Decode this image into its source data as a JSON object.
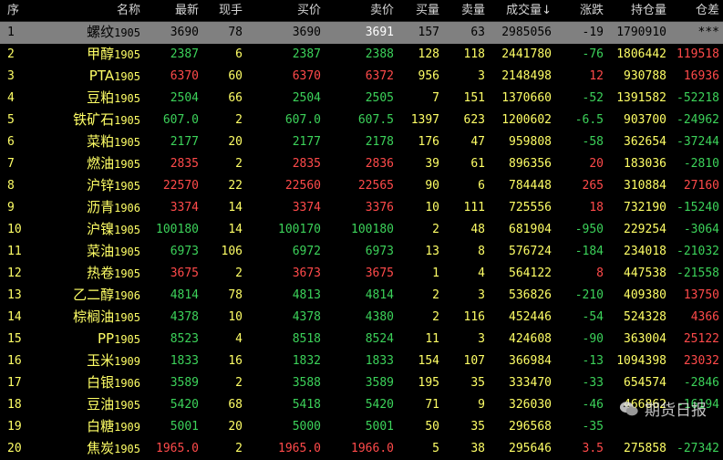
{
  "columns": [
    "序",
    "名称",
    "最新",
    "现手",
    "买价",
    "卖价",
    "买量",
    "卖量",
    "成交量↓",
    "涨跌",
    "持仓量",
    "仓差"
  ],
  "rows": [
    {
      "seq": "1",
      "name": "螺纹",
      "code": "1905",
      "last": "3690",
      "hand": "78",
      "bid": "3690",
      "ask": "3691",
      "bidv": "157",
      "askv": "63",
      "vol": "2985056",
      "chg": "-19",
      "oi": "1790910",
      "oichg": "***",
      "dir": "dn",
      "oidir": "up",
      "selected": true
    },
    {
      "seq": "2",
      "name": "甲醇",
      "code": "1905",
      "last": "2387",
      "hand": "6",
      "bid": "2387",
      "ask": "2388",
      "bidv": "128",
      "askv": "118",
      "vol": "2441780",
      "chg": "-76",
      "oi": "1806442",
      "oichg": "119518",
      "dir": "dn",
      "oidir": "up"
    },
    {
      "seq": "3",
      "name": "PTA",
      "code": "1905",
      "last": "6370",
      "hand": "60",
      "bid": "6370",
      "ask": "6372",
      "bidv": "956",
      "askv": "3",
      "vol": "2148498",
      "chg": "12",
      "oi": "930788",
      "oichg": "16936",
      "dir": "up",
      "oidir": "up"
    },
    {
      "seq": "4",
      "name": "豆粕",
      "code": "1905",
      "last": "2504",
      "hand": "66",
      "bid": "2504",
      "ask": "2505",
      "bidv": "7",
      "askv": "151",
      "vol": "1370660",
      "chg": "-52",
      "oi": "1391582",
      "oichg": "-52218",
      "dir": "dn",
      "oidir": "dn"
    },
    {
      "seq": "5",
      "name": "铁矿石",
      "code": "1905",
      "last": "607.0",
      "hand": "2",
      "bid": "607.0",
      "ask": "607.5",
      "bidv": "1397",
      "askv": "623",
      "vol": "1200602",
      "chg": "-6.5",
      "oi": "903700",
      "oichg": "-24962",
      "dir": "dn",
      "oidir": "dn"
    },
    {
      "seq": "6",
      "name": "菜粕",
      "code": "1905",
      "last": "2177",
      "hand": "20",
      "bid": "2177",
      "ask": "2178",
      "bidv": "176",
      "askv": "47",
      "vol": "959808",
      "chg": "-58",
      "oi": "362654",
      "oichg": "-37244",
      "dir": "dn",
      "oidir": "dn"
    },
    {
      "seq": "7",
      "name": "燃油",
      "code": "1905",
      "last": "2835",
      "hand": "2",
      "bid": "2835",
      "ask": "2836",
      "bidv": "39",
      "askv": "61",
      "vol": "896356",
      "chg": "20",
      "oi": "183036",
      "oichg": "-2810",
      "dir": "up",
      "oidir": "dn"
    },
    {
      "seq": "8",
      "name": "沪锌",
      "code": "1905",
      "last": "22570",
      "hand": "22",
      "bid": "22560",
      "ask": "22565",
      "bidv": "90",
      "askv": "6",
      "vol": "784448",
      "chg": "265",
      "oi": "310884",
      "oichg": "27160",
      "dir": "up",
      "oidir": "up"
    },
    {
      "seq": "9",
      "name": "沥青",
      "code": "1906",
      "last": "3374",
      "hand": "14",
      "bid": "3374",
      "ask": "3376",
      "bidv": "10",
      "askv": "111",
      "vol": "725556",
      "chg": "18",
      "oi": "732190",
      "oichg": "-15240",
      "dir": "up",
      "oidir": "dn"
    },
    {
      "seq": "10",
      "name": "沪镍",
      "code": "1905",
      "last": "100180",
      "hand": "14",
      "bid": "100170",
      "ask": "100180",
      "bidv": "2",
      "askv": "48",
      "vol": "681904",
      "chg": "-950",
      "oi": "229254",
      "oichg": "-3064",
      "dir": "dn",
      "oidir": "dn"
    },
    {
      "seq": "11",
      "name": "菜油",
      "code": "1905",
      "last": "6973",
      "hand": "106",
      "bid": "6972",
      "ask": "6973",
      "bidv": "13",
      "askv": "8",
      "vol": "576724",
      "chg": "-184",
      "oi": "234018",
      "oichg": "-21032",
      "dir": "dn",
      "oidir": "dn"
    },
    {
      "seq": "12",
      "name": "热卷",
      "code": "1905",
      "last": "3675",
      "hand": "2",
      "bid": "3673",
      "ask": "3675",
      "bidv": "1",
      "askv": "4",
      "vol": "564122",
      "chg": "8",
      "oi": "447538",
      "oichg": "-21558",
      "dir": "up",
      "oidir": "dn"
    },
    {
      "seq": "13",
      "name": "乙二醇",
      "code": "1906",
      "last": "4814",
      "hand": "78",
      "bid": "4813",
      "ask": "4814",
      "bidv": "2",
      "askv": "3",
      "vol": "536826",
      "chg": "-210",
      "oi": "409380",
      "oichg": "13750",
      "dir": "dn",
      "oidir": "up"
    },
    {
      "seq": "14",
      "name": "棕榈油",
      "code": "1905",
      "last": "4378",
      "hand": "10",
      "bid": "4378",
      "ask": "4380",
      "bidv": "2",
      "askv": "116",
      "vol": "452446",
      "chg": "-54",
      "oi": "524328",
      "oichg": "4366",
      "dir": "dn",
      "oidir": "up"
    },
    {
      "seq": "15",
      "name": "PP",
      "code": "1905",
      "last": "8523",
      "hand": "4",
      "bid": "8518",
      "ask": "8524",
      "bidv": "11",
      "askv": "3",
      "vol": "424608",
      "chg": "-90",
      "oi": "363004",
      "oichg": "25122",
      "dir": "dn",
      "oidir": "up"
    },
    {
      "seq": "16",
      "name": "玉米",
      "code": "1909",
      "last": "1833",
      "hand": "16",
      "bid": "1832",
      "ask": "1833",
      "bidv": "154",
      "askv": "107",
      "vol": "366984",
      "chg": "-13",
      "oi": "1094398",
      "oichg": "23032",
      "dir": "dn",
      "oidir": "up"
    },
    {
      "seq": "17",
      "name": "白银",
      "code": "1906",
      "last": "3589",
      "hand": "2",
      "bid": "3588",
      "ask": "3589",
      "bidv": "195",
      "askv": "35",
      "vol": "333470",
      "chg": "-33",
      "oi": "654574",
      "oichg": "-2846",
      "dir": "dn",
      "oidir": "dn"
    },
    {
      "seq": "18",
      "name": "豆油",
      "code": "1905",
      "last": "5420",
      "hand": "68",
      "bid": "5418",
      "ask": "5420",
      "bidv": "71",
      "askv": "9",
      "vol": "326030",
      "chg": "-46",
      "oi": "466862",
      "oichg": "-16194",
      "dir": "dn",
      "oidir": "dn"
    },
    {
      "seq": "19",
      "name": "白糖",
      "code": "1909",
      "last": "5001",
      "hand": "20",
      "bid": "5000",
      "ask": "5001",
      "bidv": "50",
      "askv": "35",
      "vol": "296568",
      "chg": "-35",
      "oi": "",
      "oichg": "",
      "dir": "dn",
      "oidir": "dn"
    },
    {
      "seq": "20",
      "name": "焦炭",
      "code": "1905",
      "last": "1965.0",
      "hand": "2",
      "bid": "1965.0",
      "ask": "1966.0",
      "bidv": "5",
      "askv": "38",
      "vol": "295646",
      "chg": "3.5",
      "oi": "275858",
      "oichg": "-27342",
      "dir": "up",
      "oidir": "dn"
    }
  ],
  "watermark": {
    "text": "期货日报",
    "icon": "wechat-icon"
  },
  "colors": {
    "up": "#ff4a4a",
    "down": "#3cd25a",
    "neutral": "#ffff66",
    "volume": "#2fd8e8"
  }
}
